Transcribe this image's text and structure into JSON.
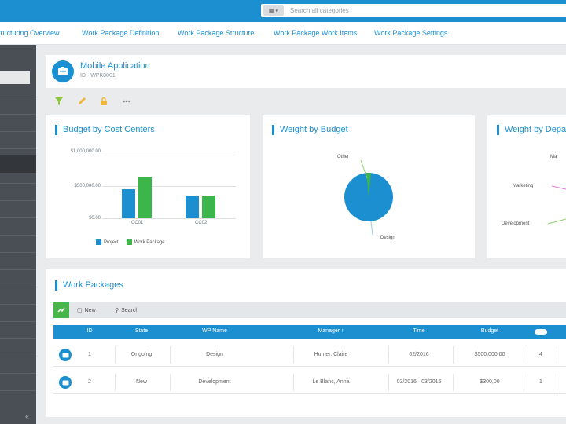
{
  "search": {
    "placeholder": "Search all categories"
  },
  "nav": {
    "items": [
      {
        "label": "Structuring Overview"
      },
      {
        "label": "Work Package Definition"
      },
      {
        "label": "Work Package Structure"
      },
      {
        "label": "Work Package Work Items"
      },
      {
        "label": "Work Package Settings"
      }
    ]
  },
  "header": {
    "title": "Mobile Application",
    "subtitle": "ID · WPK0001"
  },
  "icons": {
    "filter": "filter-icon",
    "edit": "edit-icon",
    "lock": "lock-icon",
    "more": "more-icon"
  },
  "colors": {
    "accent": "#1b8fd0",
    "green": "#3cb54a",
    "sidebar": "#4a4f55"
  },
  "panels": {
    "budget": {
      "title": "Budget by Cost Centers"
    },
    "weight": {
      "title": "Weight by Budget"
    },
    "weight_dept": {
      "title": "Weight by Department"
    }
  },
  "chart_data": [
    {
      "type": "bar",
      "title": "Budget by Cost Centers",
      "categories": [
        "CC01",
        "CC02"
      ],
      "y_ticks": [
        "$1,000,000.00",
        "$500,000.00",
        "$0.00"
      ],
      "ylim": [
        0,
        1000000
      ],
      "series": [
        {
          "name": "Project",
          "color": "#1b8fd0",
          "values": [
            440000,
            340000
          ]
        },
        {
          "name": "Work Package",
          "color": "#3cb54a",
          "values": [
            620000,
            340000
          ]
        }
      ],
      "legend": "bottom",
      "grid": true
    },
    {
      "type": "pie",
      "title": "Weight by Budget",
      "labels": [
        "Other",
        "Design"
      ],
      "values": [
        3,
        97
      ]
    },
    {
      "type": "pie",
      "title": "Weight by Department",
      "labels": [
        "Marketing",
        "Development"
      ],
      "values": [],
      "partial": true
    }
  ],
  "work_packages": {
    "title": "Work Packages",
    "toolbar": {
      "new_label": "New",
      "search_label": "Search"
    },
    "columns": [
      "ID",
      "State",
      "WP Name",
      "Manager ↑",
      "Time",
      "Budget"
    ],
    "rows": [
      {
        "id": "1",
        "state": "Ongoing",
        "name": "Design",
        "manager": "Hunter, Claire",
        "time": "02/2016",
        "budget": "$500,000.00",
        "extra": "4"
      },
      {
        "id": "2",
        "state": "New",
        "name": "Development",
        "manager": "Le Blanc, Anna",
        "time": "03/2016 · 03/2016",
        "budget": "$300,00",
        "extra": "1"
      }
    ]
  }
}
